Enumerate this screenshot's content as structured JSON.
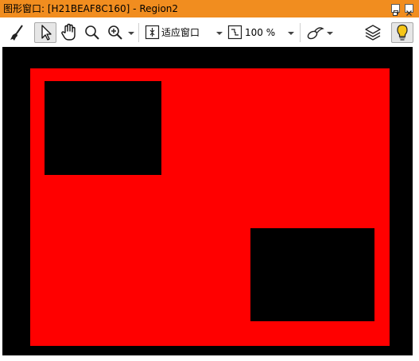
{
  "window": {
    "title": "图形窗口: [H21BEAF8C160] - Region2",
    "controls": [
      "restore-icon",
      "close-icon"
    ]
  },
  "toolbar": {
    "tools": [
      "broom-icon",
      "pointer-icon",
      "hand-pan-icon",
      "zoom-icon",
      "zoom-in-icon"
    ],
    "fit_label": "适应窗口",
    "zoom_label": "100 %",
    "extra_icons": [
      "draw-region-icon",
      "layers-icon",
      "lightbulb-icon"
    ]
  },
  "canvas": {
    "background": "#000000",
    "region_color": "#ff0000",
    "hole_color": "#000000"
  },
  "colors": {
    "titlebar": "#f18d1f"
  }
}
